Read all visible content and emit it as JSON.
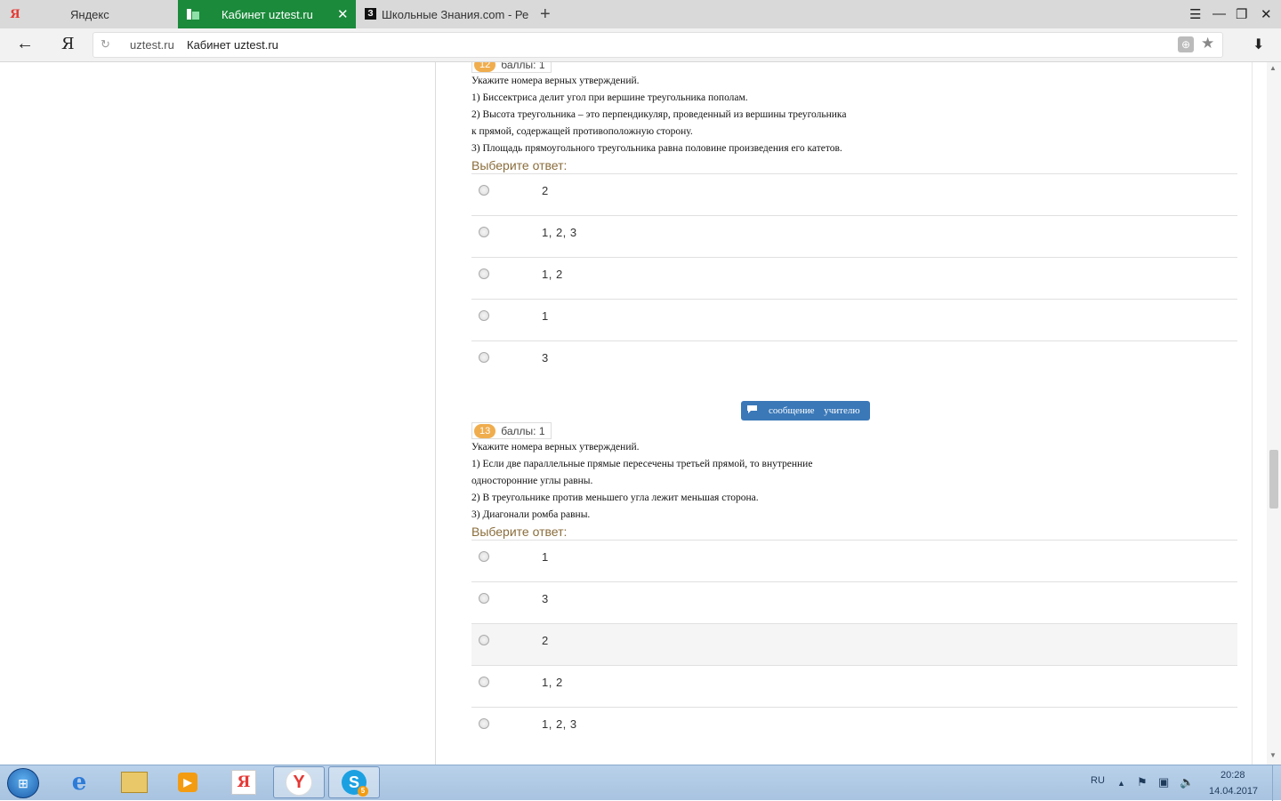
{
  "browser": {
    "tabs": [
      {
        "icon": "Я",
        "title": "Яндекс"
      },
      {
        "icon": "",
        "title": "Кабинет uztest.ru",
        "close": "✕"
      },
      {
        "icon": "З",
        "title": "Школьные Знания.com - Ре"
      }
    ],
    "new_tab": "+",
    "window_controls": {
      "menu": "☰",
      "minimize": "—",
      "restore": "❐",
      "close": "✕"
    },
    "nav": {
      "back": "←",
      "yandex": "Я",
      "reload": "↻",
      "download": "⬇"
    },
    "address": {
      "domain": "uztest.ru",
      "title": "Кабинет uztest.ru"
    }
  },
  "questions": [
    {
      "number": "12",
      "points": "баллы: 1",
      "text": "Укажите номера верных утверждений.\n1) Биссектриса делит угол при вершине треугольника пополам.\n2) Высота треугольника – это перпендикуляр, проведенный из вершины треугольника\nк прямой, содержащей противоположную сторону.\n3) Площадь прямоугольного треугольника равна половине произведения его катетов.",
      "prompt": "Выберите ответ:",
      "answers": [
        "2",
        "1, 2, 3",
        "1, 2",
        "1",
        "3"
      ]
    },
    {
      "number": "13",
      "points": "баллы: 1",
      "text": "Укажите номера верных утверждений.\n1) Если две параллельные прямые пересечены третьей прямой, то внутренние\nодносторонние углы равны.\n2) В треугольнике против меньшего угла лежит меньшая сторона.\n3) Диагонали ромба равны.",
      "prompt": "Выберите ответ:",
      "answers": [
        "1",
        "3",
        "2",
        "1, 2",
        "1, 2, 3"
      ],
      "highlighted_answer": "2"
    }
  ],
  "message_button": {
    "label": "сообщение учителю"
  },
  "taskbar": {
    "start": "⊞",
    "apps": [
      {
        "name": "Internet Explorer",
        "glyph": "e"
      },
      {
        "name": "Explorer",
        "glyph": ""
      },
      {
        "name": "Media",
        "glyph": "▶"
      },
      {
        "name": "Яндекс",
        "glyph": "Я"
      },
      {
        "name": "Yandex Browser",
        "glyph": "Y"
      },
      {
        "name": "Skype",
        "glyph": "S",
        "badge": "5"
      }
    ],
    "tray": {
      "lang": "RU",
      "time": "20:28",
      "date": "14.04.2017"
    }
  },
  "colors": {
    "active_tab": "#1b8a3b",
    "badge": "#f0ad4e",
    "prompt": "#8a6d3b",
    "message_button": "#3a78b8"
  }
}
